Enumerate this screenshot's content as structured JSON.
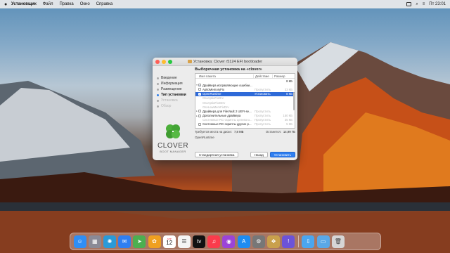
{
  "menubar": {
    "app": "Установщик",
    "menus": [
      "Файл",
      "Правка",
      "Окно",
      "Справка"
    ],
    "clock": "Пт 23:01"
  },
  "window": {
    "title": "Установка: Clover r5124 EFI bootloader",
    "steps": [
      {
        "label": "Введение",
        "state": "done"
      },
      {
        "label": "Информация",
        "state": "done"
      },
      {
        "label": "Размещение",
        "state": "done"
      },
      {
        "label": "Тип установки",
        "state": "active"
      },
      {
        "label": "Установка",
        "state": "disabled"
      },
      {
        "label": "Обзор",
        "state": "disabled"
      }
    ],
    "brand": {
      "name": "CLOVER",
      "tagline": "BOOT MANAGER"
    },
    "heading": "Выборочная установка на «clover»",
    "columns": {
      "name": "Имя пакета",
      "action": "Действие",
      "size": "Размер"
    },
    "rows": [
      {
        "tri": "",
        "checked": "",
        "name": "",
        "action": "",
        "size": "8 КБ",
        "style": ""
      },
      {
        "tri": "▾",
        "checked": "minus",
        "name": "Драйвера исправляющие ошибки...",
        "action": "",
        "size": "",
        "style": ""
      },
      {
        "tri": "",
        "checked": "no",
        "name": "AptioMemoryFix",
        "action": "Пропустить",
        "size": "33 КБ",
        "style": "dim-action"
      },
      {
        "tri": "",
        "checked": "yes",
        "name": "OpenRuntime",
        "action": "Установить",
        "size": "8 КБ",
        "style": "selected"
      },
      {
        "tri": "",
        "checked": "",
        "name": "OsxAptioFixDrv",
        "action": "",
        "size": "",
        "style": "dim"
      },
      {
        "tri": "",
        "checked": "",
        "name": "OsxAptioFix3Drv",
        "action": "",
        "size": "",
        "style": "dim"
      },
      {
        "tri": "",
        "checked": "",
        "name": "OsxLowMemFixDrv",
        "action": "",
        "size": "",
        "style": "dim"
      },
      {
        "tri": "▸",
        "checked": "no",
        "name": "Драйвера для FileVault 2 UEFI-se...",
        "action": "Пропустить",
        "size": "",
        "style": "dim-action"
      },
      {
        "tri": "▸",
        "checked": "no",
        "name": "Дополнительные драйвера",
        "action": "Пропустить",
        "size": "150 КБ",
        "style": "dim-action"
      },
      {
        "tri": "",
        "checked": "",
        "name": "Системные RC-скрипты целевого...",
        "action": "Пропустить",
        "size": "35 КБ",
        "style": "dim"
      },
      {
        "tri": "",
        "checked": "no",
        "name": "Системные RC-скрипты другие р...",
        "action": "Пропустить",
        "size": "5 КБ",
        "style": "dim-action"
      }
    ],
    "space_required_label": "Требуется места на диске:",
    "space_required": "7,8 МБ",
    "space_left_label": "Останется:",
    "space_left": "14,99 ГБ",
    "description": "OpenRuntime",
    "buttons": {
      "standard": "Стандартная установка",
      "back": "Назад",
      "install": "Установить"
    }
  },
  "dock": {
    "apps": [
      {
        "name": "finder-icon",
        "glyph": "☺",
        "color": "#2f8ef4"
      },
      {
        "name": "launchpad-icon",
        "glyph": "▦",
        "color": "#8a8a96"
      },
      {
        "name": "safari-icon",
        "glyph": "✺",
        "color": "#2a9ad8"
      },
      {
        "name": "mail-icon",
        "glyph": "✉",
        "color": "#2f7ff1"
      },
      {
        "name": "maps-icon",
        "glyph": "➤",
        "color": "#4caf50"
      },
      {
        "name": "photos-icon",
        "glyph": "✿",
        "color": "#f0a020"
      },
      {
        "name": "calendar-icon",
        "glyph": "12",
        "color": "#ffffff"
      },
      {
        "name": "reminders-icon",
        "glyph": "☰",
        "color": "#f4f4f4"
      },
      {
        "name": "tv-icon",
        "glyph": "tv",
        "color": "#111111"
      },
      {
        "name": "music-icon",
        "glyph": "♫",
        "color": "#fa3c4c"
      },
      {
        "name": "podcasts-icon",
        "glyph": "◉",
        "color": "#9b44d8"
      },
      {
        "name": "app-store-icon",
        "glyph": "A",
        "color": "#1e8cf2"
      },
      {
        "name": "system-preferences-icon",
        "glyph": "⚙",
        "color": "#777"
      },
      {
        "name": "installer-icon",
        "glyph": "❖",
        "color": "#c9a04c"
      },
      {
        "name": "feedback-icon",
        "glyph": "!",
        "color": "#6c53d8"
      }
    ],
    "right": [
      {
        "name": "downloads-folder-icon",
        "glyph": "⇩",
        "color": "#4aa6f0"
      },
      {
        "name": "preview-icon",
        "glyph": "▭",
        "color": "#5aa8e8"
      },
      {
        "name": "trash-icon",
        "glyph": "🗑",
        "color": "#d6d6d6"
      }
    ],
    "calendar": {
      "month": "АПР",
      "day": "12"
    }
  }
}
